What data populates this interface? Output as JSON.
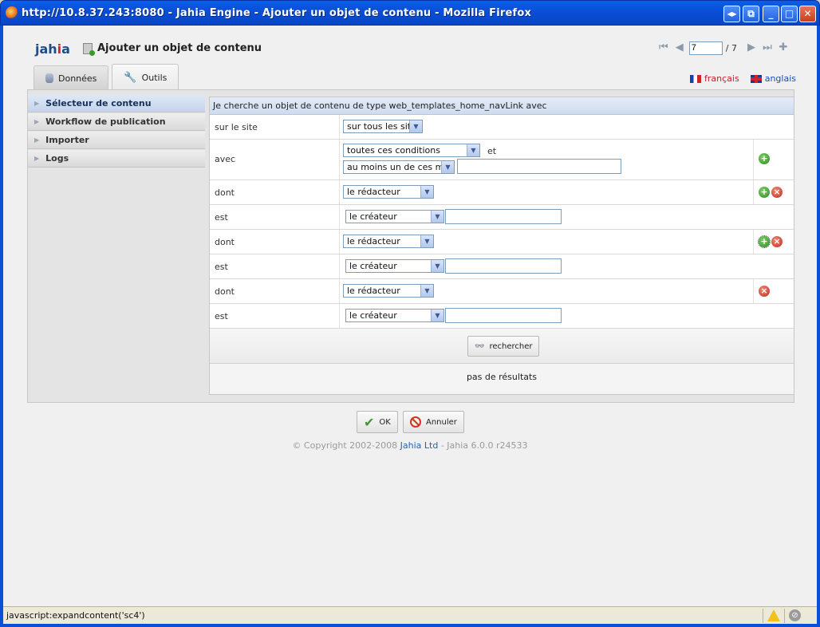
{
  "window": {
    "title": "http://10.8.37.243:8080 - Jahia Engine - Ajouter un objet de contenu - Mozilla Firefox",
    "min_glyph": "_",
    "max_glyph": "□",
    "close_glyph": "✕",
    "restore_glyph": "◂▸",
    "new_glyph": "⧉"
  },
  "header": {
    "logo_main": "jah",
    "logo_dot": "i",
    "logo_end": "a",
    "page_title": "Ajouter un objet de contenu"
  },
  "pager": {
    "current": "7",
    "total": "/ 7",
    "first_glyph": "⏮",
    "prev_glyph": "◀",
    "next_glyph": "▶",
    "last_glyph": "⏭",
    "add_glyph": "✚"
  },
  "tabs": [
    {
      "label": "Données",
      "icon": "database-icon"
    },
    {
      "label": "Outils",
      "icon": "wrench-icon"
    }
  ],
  "languages": [
    {
      "label": "français",
      "icon": "flag-fr-icon"
    },
    {
      "label": "anglais",
      "icon": "flag-en-icon"
    }
  ],
  "sidebar": {
    "items": [
      {
        "label": "Sélecteur de contenu"
      },
      {
        "label": "Workflow de publication"
      },
      {
        "label": "Importer"
      },
      {
        "label": "Logs"
      }
    ]
  },
  "form": {
    "heading": "Je cherche un objet de contenu de type web_templates_home_navLink avec",
    "site_label": "sur le site",
    "site_value": "sur tous les site:",
    "avec_label": "avec",
    "conditions_value": "toutes ces conditions",
    "et_text": "et",
    "words_value": "au moins un de ces mot:",
    "rows": [
      {
        "dont_label": "dont",
        "dont_value": "le rédacteur",
        "est_label": "est",
        "est_value": "le créateur"
      },
      {
        "dont_label": "dont",
        "dont_value": "le rédacteur",
        "est_label": "est",
        "est_value": "le créateur"
      },
      {
        "dont_label": "dont",
        "dont_value": "le rédacteur",
        "est_label": "est",
        "est_value": "le créateur"
      }
    ],
    "dropdown_glyph": "▼",
    "add_glyph": "+",
    "del_glyph": "×",
    "search_button": "rechercher",
    "search_icon_glyph": "👓",
    "results_text": "pas de résultats"
  },
  "footer": {
    "ok_label": "OK",
    "ok_glyph": "✔",
    "cancel_label": "Annuler",
    "copyright_prefix": "© Copyright 2002-2008",
    "copyright_link": "Jahia Ltd",
    "copyright_suffix": "- Jahia 6.0.0 r24533"
  },
  "statusbar": {
    "message": "javascript:expandcontent('sc4')",
    "noedit_glyph": "⊘"
  }
}
